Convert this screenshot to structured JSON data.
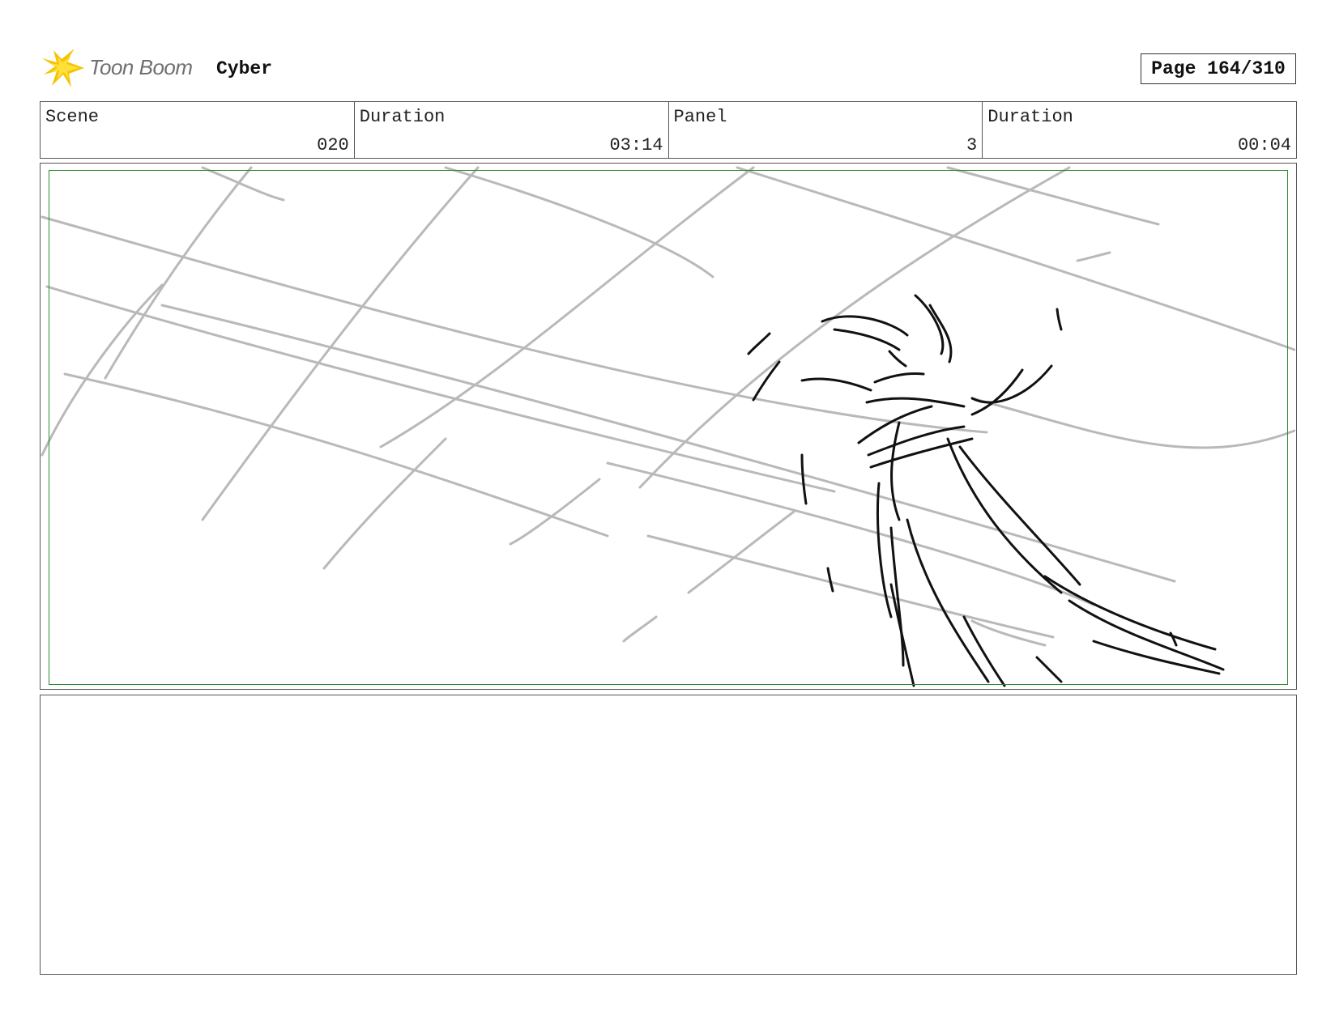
{
  "header": {
    "logo_text": "Toon Boom",
    "project_title": "Cyber",
    "page_label": "Page 164/310"
  },
  "info": {
    "scene_label": "Scene",
    "scene_value": "020",
    "scene_duration_label": "Duration",
    "scene_duration_value": "03:14",
    "panel_label": "Panel",
    "panel_value": "3",
    "panel_duration_label": "Duration",
    "panel_duration_value": "00:04"
  },
  "notes": {
    "text": ""
  },
  "colors": {
    "safe_area": "#2f8a2f",
    "logo_yellow": "#f5c400",
    "sketch_grid": "#b9b9b9",
    "sketch_ink": "#111111"
  }
}
